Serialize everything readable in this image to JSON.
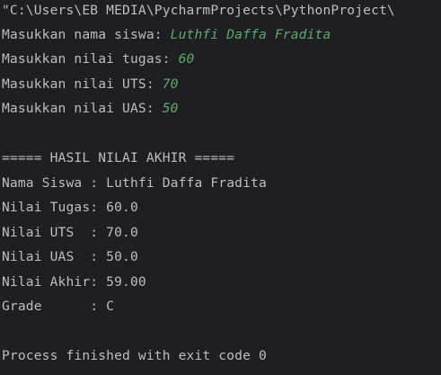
{
  "console": {
    "command": "\"C:\\Users\\EB MEDIA\\PycharmProjects\\PythonProject\\",
    "prompts": [
      {
        "label": "Masukkan nama siswa: ",
        "value": "Luthfi Daffa Fradita"
      },
      {
        "label": "Masukkan nilai tugas: ",
        "value": "60"
      },
      {
        "label": "Masukkan nilai UTS: ",
        "value": "70"
      },
      {
        "label": "Masukkan nilai UAS: ",
        "value": "50"
      }
    ],
    "result_header": "===== HASIL NILAI AKHIR =====",
    "results": [
      "Nama Siswa : Luthfi Daffa Fradita",
      "Nilai Tugas: 60.0",
      "Nilai UTS  : 70.0",
      "Nilai UAS  : 50.0",
      "Nilai Akhir: 59.00",
      "Grade      : C"
    ],
    "exit_message": "Process finished with exit code 0"
  },
  "colors": {
    "background": "#1e1f22",
    "text": "#bcbec4",
    "user_input": "#5faa6a"
  }
}
